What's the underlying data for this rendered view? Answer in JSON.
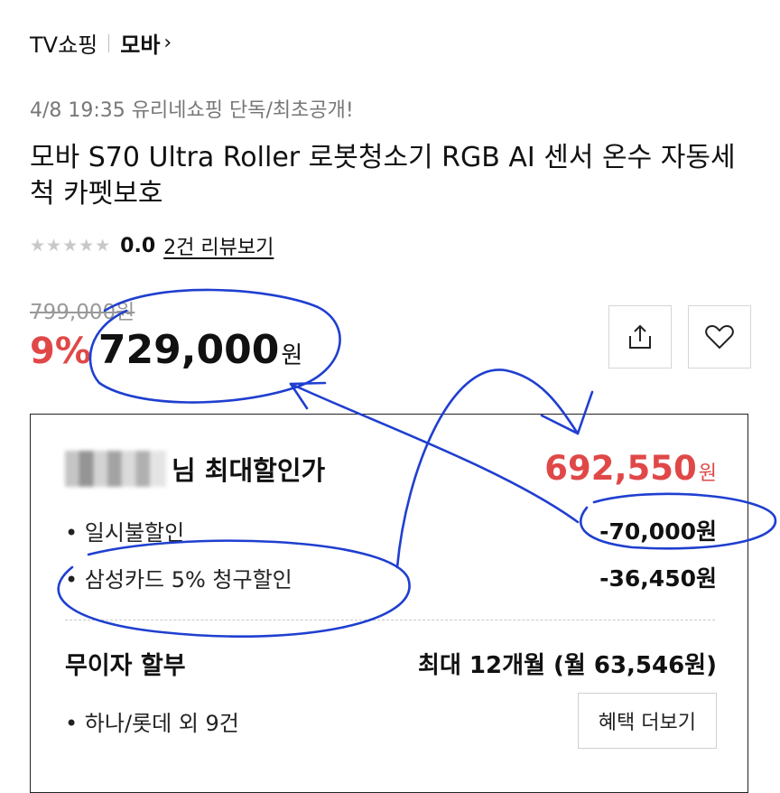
{
  "breadcrumb": {
    "category": "TV쇼핑",
    "brand": "모바",
    "chevron": "›"
  },
  "product": {
    "notice": "4/8 19:35 유리네쇼핑 단독/최초공개!",
    "title": "모바 S70 Ultra Roller 로봇청소기 RGB AI 센서 온수 자동세척 카펫보호",
    "stars": "★★★★★",
    "rating": "0.0",
    "review_link": "2건 리뷰보기",
    "rating_value": 0.0,
    "original_price": "799,000원",
    "discount_rate": "9%",
    "price": "729,000",
    "currency": "원"
  },
  "actions": {
    "share_icon": "share-icon",
    "wishlist_icon": "heart-icon"
  },
  "benefit_card": {
    "max_label": "님 최대할인가",
    "max_price": "692,550",
    "currency": "원",
    "discounts": [
      {
        "label": "• 일시불할인",
        "amount": "-70,000원"
      },
      {
        "label": "• 삼성카드 5% 청구할인",
        "amount": "-36,450원"
      }
    ],
    "installment_title": "무이자 할부",
    "installment_detail": "최대 12개월 (월 63,546원)",
    "cards": "• 하나/롯데 외 9건",
    "more_button": "혜택 더보기"
  },
  "colors": {
    "accent_red": "#e04848",
    "annotation_blue": "#1f3fd0",
    "text": "#111111"
  }
}
